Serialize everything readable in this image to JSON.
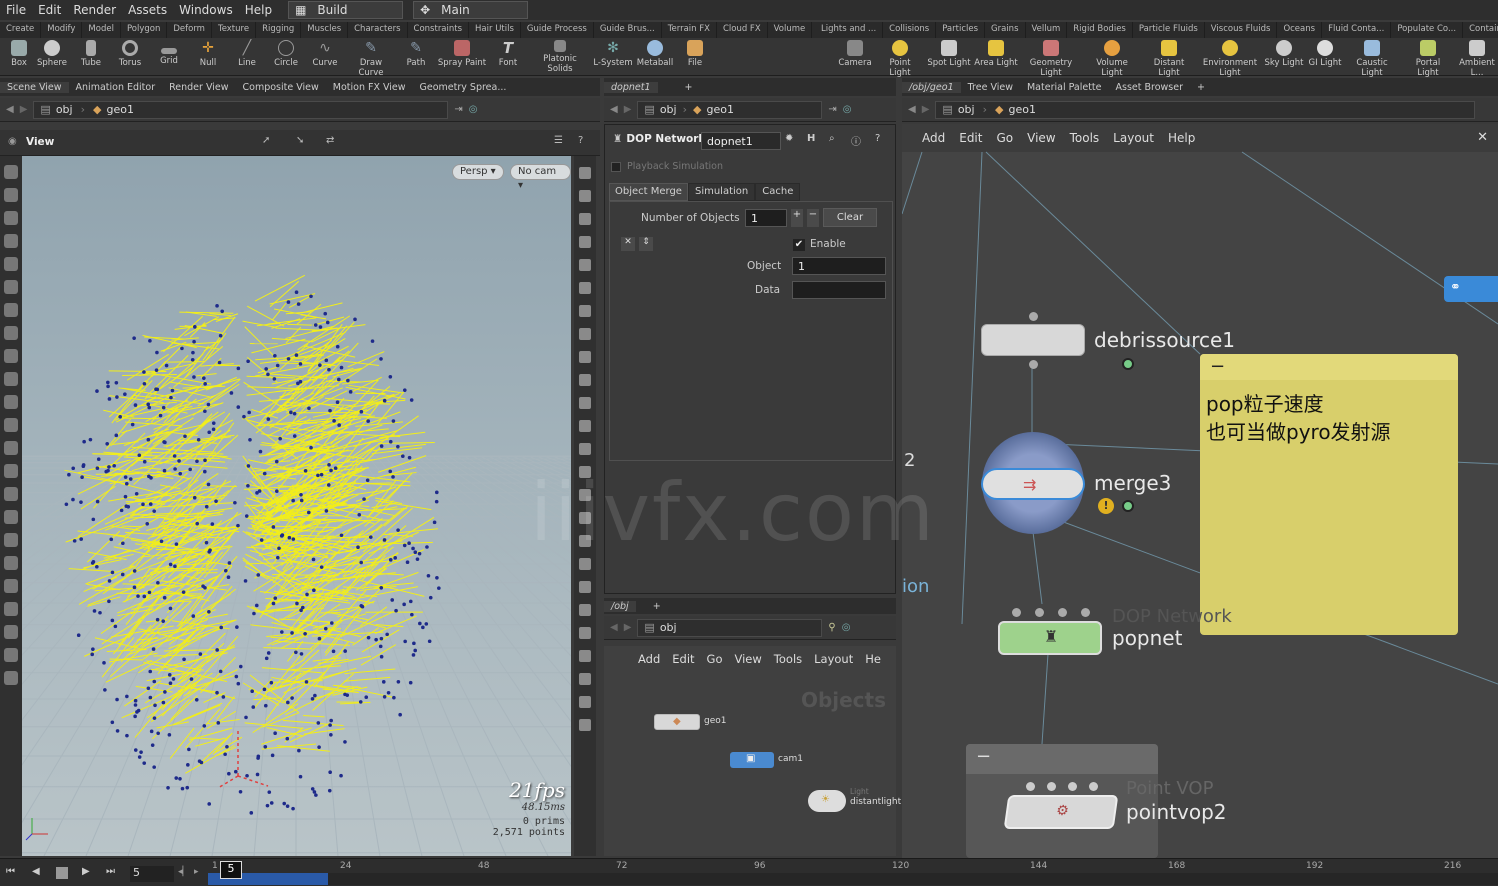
{
  "menu": {
    "items": [
      "File",
      "Edit",
      "Render",
      "Assets",
      "Windows",
      "Help"
    ],
    "desktop": "Build",
    "desktop2": "Main"
  },
  "shelf_tabs": [
    "Create",
    "Modify",
    "Model",
    "Polygon",
    "Deform",
    "Texture",
    "Rigging",
    "Muscles",
    "Characters",
    "Constraints",
    "Hair Utils",
    "Guide Process",
    "Guide Brus...",
    "Terrain FX",
    "Cloud FX",
    "Volume"
  ],
  "shelf_tabs2": [
    "Lights and ...",
    "Collisions",
    "Particles",
    "Grains",
    "Vellum",
    "Rigid Bodies",
    "Particle Fluids",
    "Viscous Fluids",
    "Oceans",
    "Fluid Conta...",
    "Populate Co...",
    "Container T..."
  ],
  "tools": [
    "Box",
    "Sphere",
    "Tube",
    "Torus",
    "Grid",
    "Null",
    "Line",
    "Circle",
    "Curve",
    "Draw Curve",
    "Path",
    "Spray Paint",
    "Font",
    "Platonic Solids",
    "L-System",
    "Metaball",
    "File"
  ],
  "tools2": [
    "Camera",
    "Point Light",
    "Spot Light",
    "Area Light",
    "Geometry Light",
    "Volume Light",
    "Distant Light",
    "Environment Light",
    "Sky Light",
    "GI Light",
    "Caustic Light",
    "Portal Light",
    "Ambient L..."
  ],
  "left_tabs": [
    "Scene View",
    "Animation Editor",
    "Render View",
    "Composite View",
    "Motion FX View",
    "Geometry Sprea..."
  ],
  "path": {
    "obj": "obj",
    "geo": "geo1"
  },
  "viewport": {
    "title": "View",
    "persp": "Persp ▾",
    "cam": "No cam ▾",
    "fps": "21fps",
    "ms": "48.15ms",
    "prims": "0  prims",
    "points": "2,571 points"
  },
  "mid": {
    "tab": "dopnet1",
    "network_label": "DOP Network",
    "network_name": "dopnet1",
    "playback": "Playback Simulation",
    "subtabs": [
      "Object Merge",
      "Simulation",
      "Cache"
    ],
    "num_objects_label": "Number of Objects",
    "num_objects": "1",
    "clear": "Clear",
    "enable": "Enable",
    "object_label": "Object",
    "object_value": "1",
    "data_label": "Data"
  },
  "obj_panel": {
    "tab": "/obj",
    "menu": [
      "Add",
      "Edit",
      "Go",
      "View",
      "Tools",
      "Layout",
      "He"
    ],
    "watermark": "Objects",
    "nodes": [
      "geo1",
      "cam1",
      "distantlight"
    ],
    "light_tag": "Light"
  },
  "right": {
    "tabs": [
      "/obj/geo1",
      "Tree View",
      "Material Palette",
      "Asset Browser"
    ],
    "menu": [
      "Add",
      "Edit",
      "Go",
      "View",
      "Tools",
      "Layout",
      "Help"
    ],
    "nodes": {
      "debris": "debrissource1",
      "merge": "merge3",
      "popnet": "popnet",
      "popnet_type": "DOP Network",
      "pointvop": "pointvop2",
      "pointvop_type": "Point VOP"
    },
    "sticky": "pop粒子速度\n也可当做pyro发射源",
    "edge_text1": "2",
    "edge_text2": "ion"
  },
  "watermark": "iiivfx.com",
  "timeline": {
    "frame": "5",
    "ticks": [
      "1",
      "24",
      "48",
      "72",
      "96",
      "120",
      "144",
      "168",
      "192",
      "216"
    ]
  },
  "colors": {
    "particle": "#f2ee1a",
    "point": "#1e2a8a",
    "sticky": "#d8cf6b",
    "popnet": "#9ed28c",
    "merge_ring": "#5a6e9c"
  }
}
